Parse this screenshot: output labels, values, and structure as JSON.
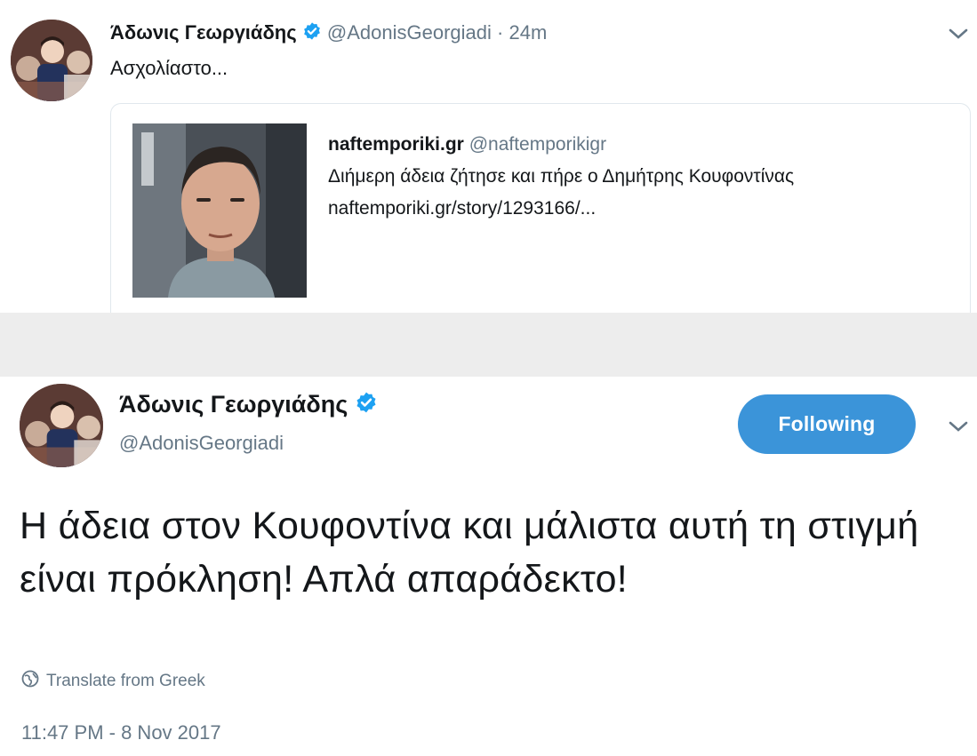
{
  "tweet1": {
    "author_name": "Άδωνις Γεωργιάδης",
    "handle": "@AdonisGeorgiadi",
    "separator": "·",
    "time": "24m",
    "text": "Ασχολίαστο...",
    "card": {
      "source_name": "naftemporiki.gr",
      "source_handle": "@naftemporikigr",
      "headline": "Διήμερη άδεια ζήτησε και πήρε ο Δημήτρης Κουφοντίνας",
      "link": "naftemporiki.gr/story/1293166/..."
    }
  },
  "tweet2": {
    "author_name": "Άδωνις Γεωργιάδης",
    "handle": "@AdonisGeorgiadi",
    "follow_label": "Following",
    "text": "Η άδεια στον Κουφοντίνα και μάλιστα αυτή τη στιγμή είναι πρόκληση! Απλά απαράδεκτο!",
    "translate_label": "Translate from Greek",
    "timestamp": "11:47 PM - 8 Nov 2017"
  },
  "icons": {
    "verified": "verified-badge-icon",
    "chevron": "chevron-down-icon",
    "globe": "globe-icon"
  },
  "colors": {
    "verified": "#1da1f2",
    "follow_button": "#3b94d9",
    "muted_text": "#657786",
    "separator": "#ededed"
  }
}
